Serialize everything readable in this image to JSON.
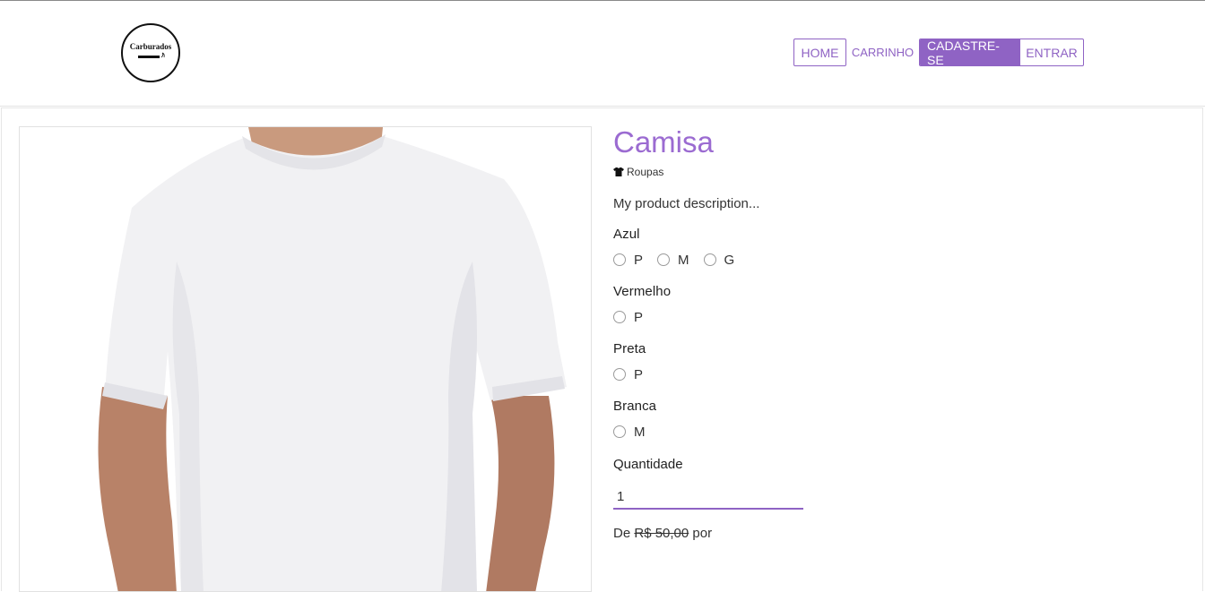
{
  "brand": {
    "logo_text": "Carburados"
  },
  "nav": {
    "home": "HOME",
    "cart": "CARRINHO",
    "signup": "CADASTRE-SE",
    "login": "ENTRAR"
  },
  "product": {
    "title": "Camisa",
    "category": "Roupas",
    "category_icon": "shirt-icon",
    "description": "My product description...",
    "variants": [
      {
        "name": "Azul",
        "sizes": [
          "P",
          "M",
          "G"
        ]
      },
      {
        "name": "Vermelho",
        "sizes": [
          "P"
        ]
      },
      {
        "name": "Preta",
        "sizes": [
          "P"
        ]
      },
      {
        "name": "Branca",
        "sizes": [
          "M"
        ]
      }
    ],
    "quantity_label": "Quantidade",
    "quantity_value": "1",
    "price_prefix": "De",
    "price_old": "R$ 50,00",
    "price_suffix": "por"
  },
  "colors": {
    "accent": "#8f63c4",
    "title": "#9b6bd1"
  }
}
